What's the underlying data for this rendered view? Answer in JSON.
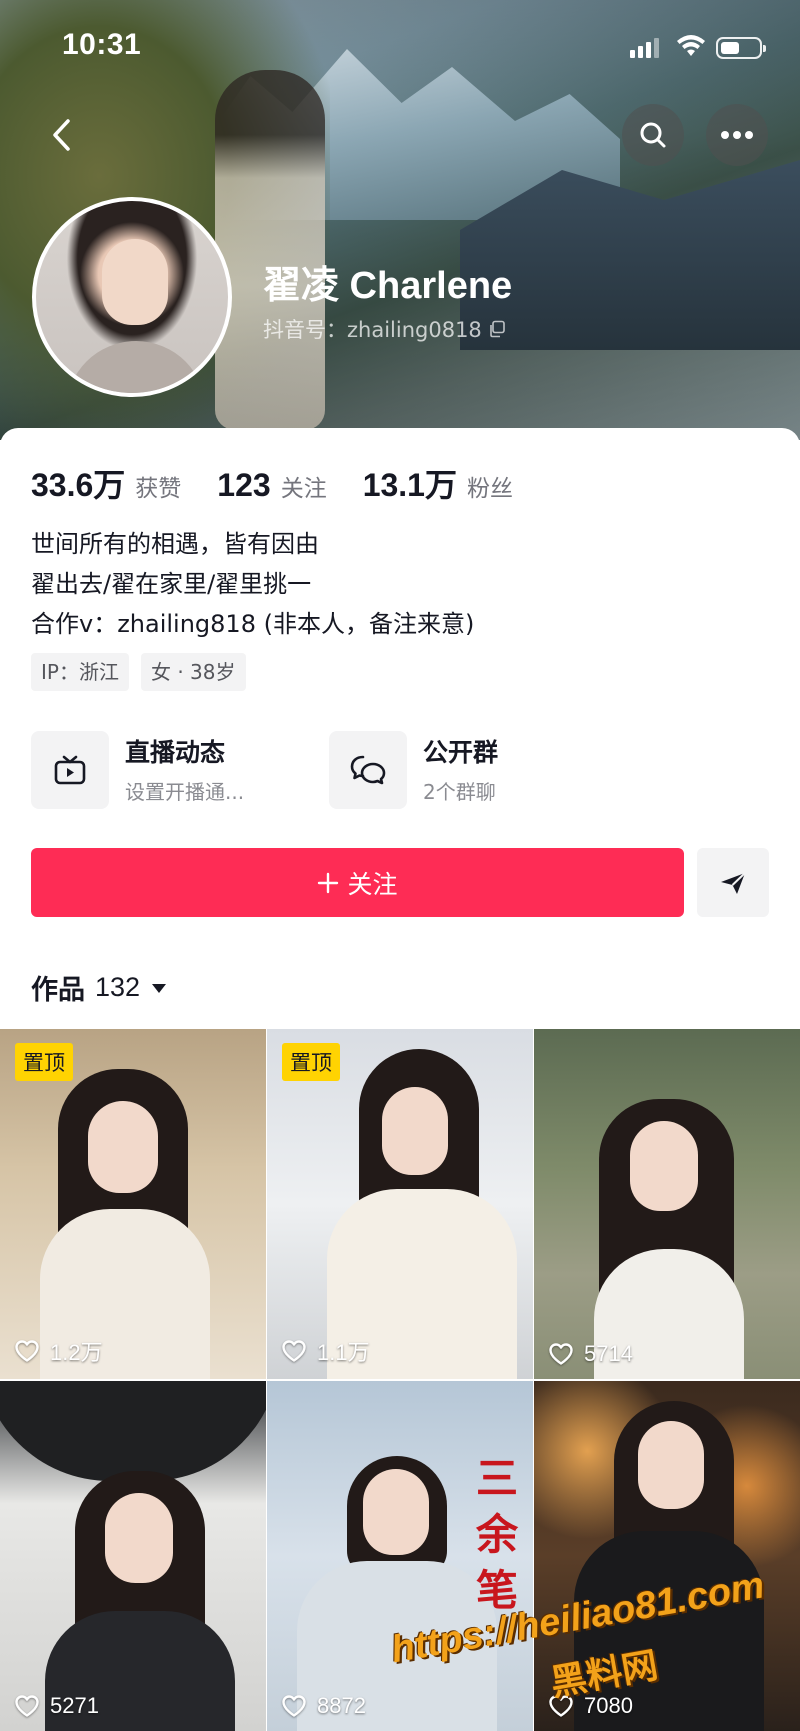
{
  "status_bar": {
    "time": "10:31"
  },
  "profile": {
    "name": "翟凌 Charlene",
    "douyin_id": "抖音号：zhailing0818"
  },
  "stats": [
    {
      "value": "33.6万",
      "label": "获赞"
    },
    {
      "value": "123",
      "label": "关注"
    },
    {
      "value": "13.1万",
      "label": "粉丝"
    }
  ],
  "bio": {
    "lines": [
      "世间所有的相遇，皆有因由",
      "翟出去/翟在家里/翟里挑一",
      "合作v：zhailing818 (非本人，备注来意)"
    ]
  },
  "tags": [
    "IP：浙江",
    "女 · 38岁"
  ],
  "features": {
    "live": {
      "title": "直播动态",
      "subtitle": "设置开播通..."
    },
    "group": {
      "title": "公开群",
      "subtitle": "2个群聊"
    }
  },
  "actions": {
    "follow_label": "关注"
  },
  "works": {
    "label": "作品",
    "count": "132"
  },
  "videos": [
    {
      "pinned": true,
      "pin_label": "置顶",
      "likes": "1.2万"
    },
    {
      "pinned": true,
      "pin_label": "置顶",
      "likes": "1.1万"
    },
    {
      "pinned": false,
      "likes": "5714"
    },
    {
      "pinned": false,
      "likes": "5271"
    },
    {
      "pinned": false,
      "likes": "8872",
      "overlay_text": "三余笔"
    },
    {
      "pinned": false,
      "likes": "7080"
    }
  ],
  "watermark": {
    "url": "https://heiliao81.com",
    "text": "黑料网"
  },
  "colors": {
    "follow": "#fe2c55",
    "pin": "#ffd302"
  }
}
